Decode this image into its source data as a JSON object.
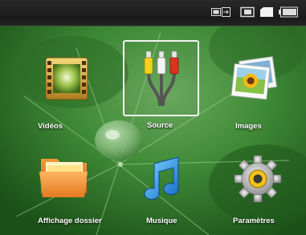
{
  "status_icons": [
    "usb-icon",
    "sd-card-icon",
    "memory-icon",
    "battery-icon"
  ],
  "menu": {
    "selected": "Source",
    "items": [
      {
        "id": "videos",
        "label": "Vidéos",
        "icon": "film-icon"
      },
      {
        "id": "source",
        "label": "Source",
        "icon": "av-cables-icon"
      },
      {
        "id": "images",
        "label": "Images",
        "icon": "photos-icon"
      },
      {
        "id": "folder",
        "label": "Affichage dossier",
        "icon": "folder-icon"
      },
      {
        "id": "music",
        "label": "Musique",
        "icon": "music-note-icon"
      },
      {
        "id": "settings",
        "label": "Paramètres",
        "icon": "gear-icon"
      }
    ]
  }
}
